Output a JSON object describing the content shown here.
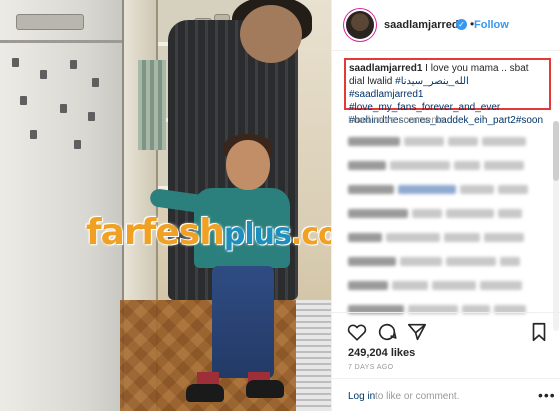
{
  "header": {
    "username": "saadlamjarred1",
    "separator": "•",
    "follow_label": "Follow"
  },
  "caption": {
    "username": "saadlamjarred1",
    "text": " I love you mama .. sbat dial lwalid ",
    "tag_arabic": "#الله_ينصر_سيدنا",
    "tag1": " #saadlamjarred1",
    "tag2": "#love_my_fans_forever_and_ever",
    "tag3": "#behindthescenes_baddek_eih_part2",
    "tag4": "#soon"
  },
  "load_more_label": "Load more comments",
  "likes_text": "249,204 likes",
  "time_text": "7 DAYS AGO",
  "login": {
    "link": "Log in",
    "rest": " to like or comment.",
    "more": "•••"
  },
  "watermark": {
    "part1": "farfesh",
    "part2": "plus",
    "part3": ".com"
  },
  "icons": {
    "verified": "verified-badge-icon",
    "heart": "heart-icon",
    "comment": "comment-icon",
    "share": "share-icon",
    "save": "bookmark-icon"
  },
  "colors": {
    "accent": "#3897f0",
    "highlight_border": "#e53935",
    "watermark_orange": "#f0a123",
    "watermark_blue": "#1d8fbf"
  }
}
